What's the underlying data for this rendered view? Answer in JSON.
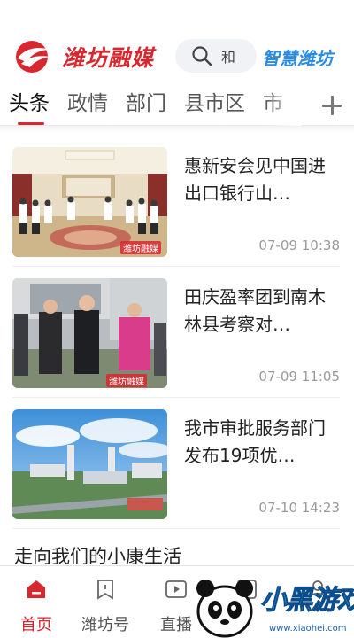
{
  "header": {
    "logo_text": "潍坊融媒",
    "search_placeholder": "和",
    "brand2": "智慧潍坊"
  },
  "tabs": [
    {
      "label": "头条",
      "active": true
    },
    {
      "label": "政情"
    },
    {
      "label": "部门"
    },
    {
      "label": "县市区"
    },
    {
      "label": "市"
    }
  ],
  "news": [
    {
      "title": "惠新安会见中国进出口银行山…",
      "time": "07-09 10:38",
      "watermark": "潍坊融媒"
    },
    {
      "title": "田庆盈率团到南木林县考察对…",
      "time": "07-09 11:05",
      "watermark": "潍坊融媒"
    },
    {
      "title": "我市审批服务部门发布19项优…",
      "time": "07-10 14:23"
    }
  ],
  "plain_item": "走向我们的小康生活",
  "bottom_nav": [
    {
      "label": "首页",
      "icon": "home-icon",
      "active": true
    },
    {
      "label": "潍坊号",
      "icon": "bookmark-icon"
    },
    {
      "label": "直播",
      "icon": "video-icon"
    },
    {
      "label": "",
      "icon": "grid-icon"
    },
    {
      "label": "",
      "icon": "user-icon"
    }
  ],
  "watermark": {
    "brand": "小黑游戏",
    "url": "www.xiaohei.com"
  },
  "colors": {
    "accent": "#d7282f",
    "brand_blue": "#2a8be0"
  }
}
